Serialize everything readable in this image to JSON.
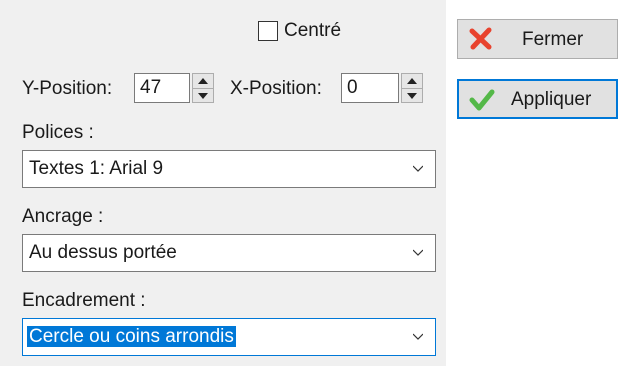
{
  "centered": {
    "label": "Centré",
    "checked": false
  },
  "y_position": {
    "label": "Y-Position:",
    "value": "47"
  },
  "x_position": {
    "label": "X-Position:",
    "value": "0"
  },
  "fonts": {
    "label": "Polices :",
    "selected": "Textes 1: Arial 9"
  },
  "anchor": {
    "label": "Ancrage :",
    "selected": "Au dessus portée"
  },
  "frame": {
    "label": "Encadrement :",
    "selected": "Cercle ou coins arrondis"
  },
  "buttons": {
    "close": "Fermer",
    "apply": "Appliquer"
  },
  "colors": {
    "accent": "#0078d7",
    "close_icon": "#e8432e",
    "apply_icon": "#54b848"
  }
}
